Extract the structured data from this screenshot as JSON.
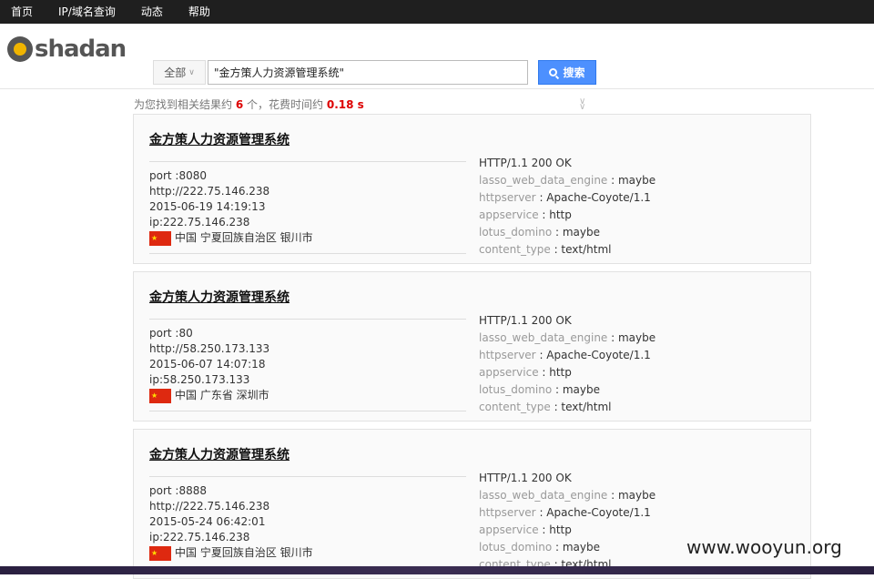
{
  "nav": {
    "items": [
      "首页",
      "IP/域名查询",
      "动态",
      "帮助"
    ]
  },
  "logo": {
    "text": "shadan"
  },
  "search": {
    "scope_label": "全部",
    "query": "\"金方策人力资源管理系统\"",
    "button_label": "搜索"
  },
  "stats": {
    "prefix": "为您找到相关结果约",
    "count": "6",
    "mid": "个，花费时间约",
    "time": "0.18 s"
  },
  "results": [
    {
      "title": "金方策人力资源管理系统",
      "port": "port :8080",
      "url": "http://222.75.146.238",
      "date": "2015-06-19 14:19:13",
      "ip": "ip:222.75.146.238",
      "location": "中国 宁夏回族自治区 银川市",
      "status": "HTTP/1.1 200 OK",
      "fields": [
        {
          "k": "lasso_web_data_engine",
          "v": "maybe"
        },
        {
          "k": "httpserver",
          "v": "Apache-Coyote/1.1"
        },
        {
          "k": "appservice",
          "v": "http"
        },
        {
          "k": "lotus_domino",
          "v": "maybe"
        },
        {
          "k": "content_type",
          "v": "text/html"
        }
      ]
    },
    {
      "title": "金方策人力资源管理系统",
      "port": "port :80",
      "url": "http://58.250.173.133",
      "date": "2015-06-07 14:07:18",
      "ip": "ip:58.250.173.133",
      "location": "中国 广东省 深圳市",
      "status": "HTTP/1.1 200 OK",
      "fields": [
        {
          "k": "lasso_web_data_engine",
          "v": "maybe"
        },
        {
          "k": "httpserver",
          "v": "Apache-Coyote/1.1"
        },
        {
          "k": "appservice",
          "v": "http"
        },
        {
          "k": "lotus_domino",
          "v": "maybe"
        },
        {
          "k": "content_type",
          "v": "text/html"
        }
      ]
    },
    {
      "title": "金方策人力资源管理系统",
      "port": "port :8888",
      "url": "http://222.75.146.238",
      "date": "2015-05-24 06:42:01",
      "ip": "ip:222.75.146.238",
      "location": "中国 宁夏回族自治区 银川市",
      "status": "HTTP/1.1 200 OK",
      "fields": [
        {
          "k": "lasso_web_data_engine",
          "v": "maybe"
        },
        {
          "k": "httpserver",
          "v": "Apache-Coyote/1.1"
        },
        {
          "k": "appservice",
          "v": "http"
        },
        {
          "k": "lotus_domino",
          "v": "maybe"
        },
        {
          "k": "content_type",
          "v": "text/html"
        }
      ]
    }
  ],
  "watermark": "www.wooyun.org"
}
